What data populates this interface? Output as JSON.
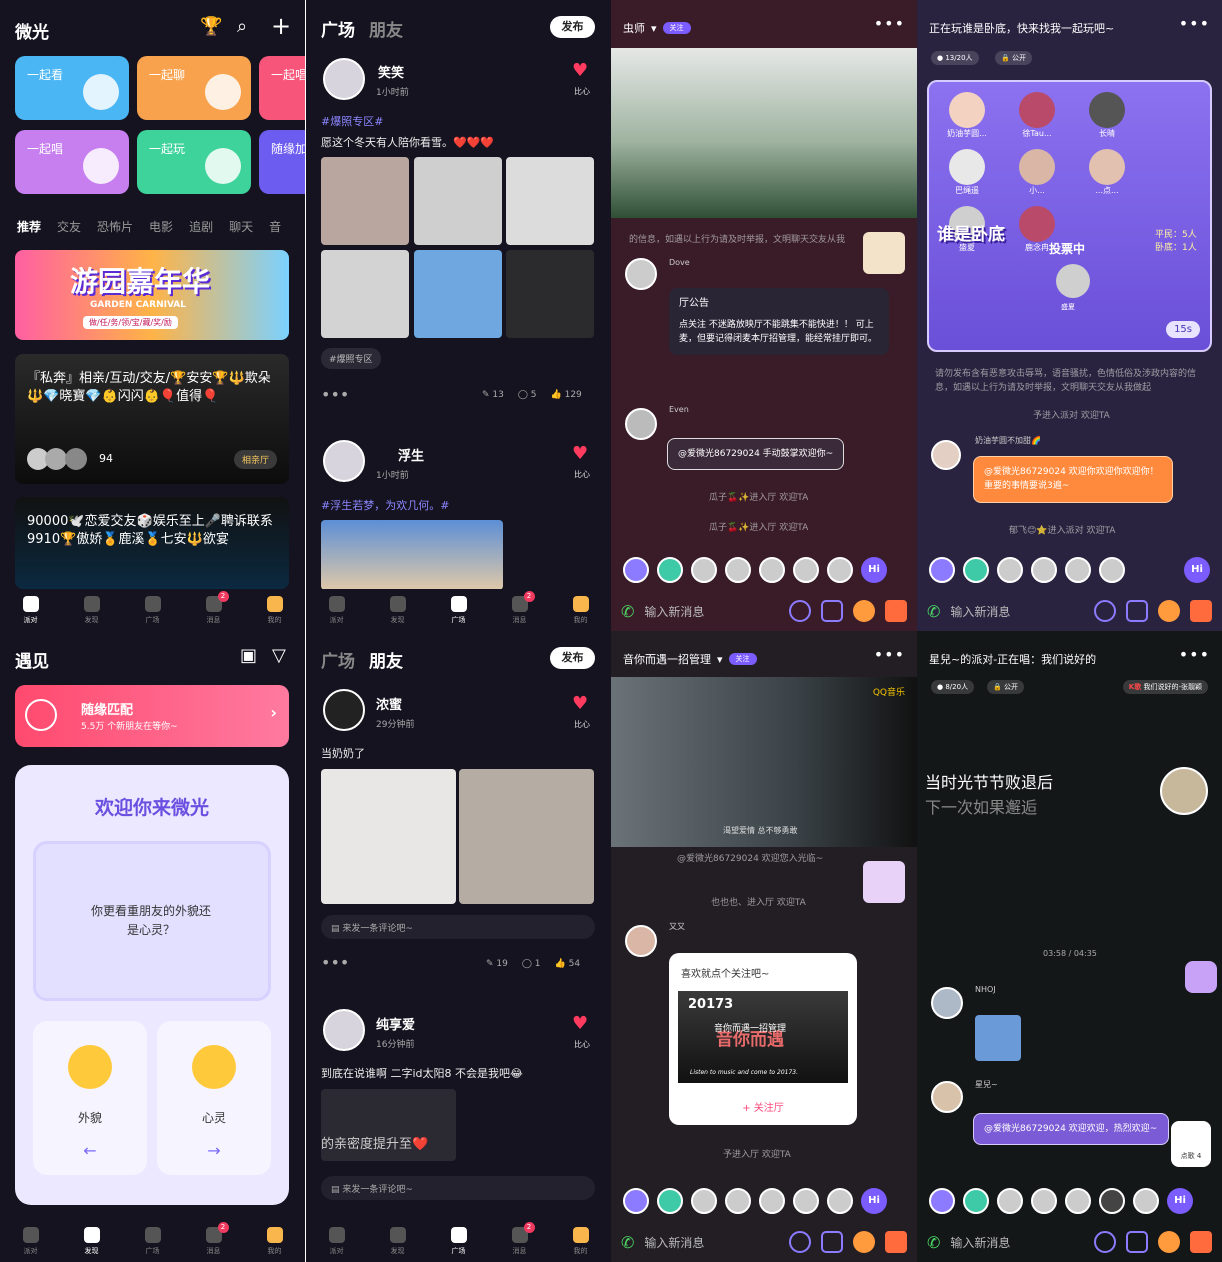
{
  "p1": {
    "title": "微光",
    "quick": [
      "一起看",
      "一起聊",
      "一起唱",
      "一起唱",
      "一起玩",
      "随缘加"
    ],
    "categories": [
      "推荐",
      "交友",
      "恐怖片",
      "电影",
      "追剧",
      "聊天",
      "音"
    ],
    "banner1": {
      "title": "游园嘉年华",
      "sub": "GARDEN CARNIVAL",
      "tags": "做/任/务/领/宝/藏/奖/励"
    },
    "room1": {
      "text": "『私奔』相亲/互动/交友/🏆安安🏆🔱欺朵🔱💎晓寶💎👶闪闪👶🎈值得🎈",
      "count": "94",
      "badge": "相亲厅"
    },
    "room2": {
      "text": "90000🕊️恋爱交友🎲娱乐至上🎤聘诉联系9910🏆傲娇🏅鹿溪🏅七安🔱欲宴"
    },
    "nav": [
      "派对",
      "发现",
      "广场",
      "消息",
      "我的"
    ],
    "nav_badge": "2"
  },
  "p2": {
    "tabs": [
      "广场",
      "朋友"
    ],
    "publish": "发布",
    "post1": {
      "name": "笑笑",
      "time": "1小时前",
      "tag": "#爆照专区#",
      "text": "愿这个冬天有人陪你看雪。❤️❤️❤️",
      "chip": "#爆照专区",
      "edits": "13",
      "comments": "5",
      "likes": "129"
    },
    "post2": {
      "name": "浮生",
      "time": "1小时前",
      "tag": "#浮生若梦，为欢几何。#"
    },
    "bixin": "比心",
    "nav": [
      "派对",
      "发现",
      "广场",
      "消息",
      "我的"
    ],
    "nav_badge": "2"
  },
  "p3": {
    "room": "虫师",
    "follow": "关注",
    "notice_head": "厅公告",
    "notice": "点关注 不迷路放映厅不能跳集不能快进！！ 可上麦，但要记得闭麦本厅招管理，能经常挂厅即可。",
    "sys_top": "的信息，如遇以上行为请及时举报，文明聊天交友从我",
    "user1": "Dove",
    "user2": "Even",
    "welcome": "@爱微光86729024 手动鼓掌欢迎你~",
    "join1": "瓜子🍒✨进入厅 欢迎TA",
    "join2": "瓜子🍒✨进入厅 欢迎TA",
    "input": "输入新消息",
    "hi": "Hi"
  },
  "p4": {
    "room": "正在玩谁是卧底，快来找我一起玩吧~",
    "count": "13/20人",
    "public": "公开",
    "game": "谁是卧底",
    "voting": "投票中",
    "civ": "平民：5人",
    "spy": "卧底：1人",
    "timer": "15s",
    "players": [
      "奶油芋圆...",
      "徐Tau...",
      "长晴",
      "巴绳遥",
      "小...",
      "...点...",
      "盛夏",
      "鹿念冉"
    ],
    "voted": "盛夏",
    "sys": "请勿发布含有恶意攻击辱骂，语音骚扰，色情低俗及涉政内容的信息，如遇以上行为请及时举报，文明聊天交友从我做起",
    "join1": "予进入派对 欢迎TA",
    "user": "奶油芋圆不加甜🌈",
    "welcome": "@爱微光86729024 欢迎你欢迎你欢迎你！重要的事情要说3遍~",
    "join2": "郁飞😊⭐进入派对 欢迎TA",
    "input": "输入新消息",
    "hi": "Hi"
  },
  "p5": {
    "title": "遇见",
    "match_title": "随缘匹配",
    "match_sub": "5.5万 个新朋友在等你~",
    "welcome": "欢迎你来微光",
    "question": "你更看重朋友的外貌还是心灵？",
    "opt1": "外貌",
    "opt2": "心灵",
    "nav": [
      "派对",
      "发现",
      "广场",
      "消息",
      "我的"
    ],
    "nav_badge": "2"
  },
  "p6": {
    "tabs": [
      "广场",
      "朋友"
    ],
    "publish": "发布",
    "post1": {
      "name": "浓蜜",
      "time": "29分钟前",
      "text": "当奶奶了",
      "comment": "来发一条评论吧~",
      "edits": "19",
      "comments": "1",
      "likes": "54"
    },
    "post2": {
      "name": "纯享爱",
      "time": "16分钟前",
      "text": "到底在说谁啊 二字id太阳8 不会是我吧😂",
      "overlay": "的亲密度提升至❤️",
      "comment": "来发一条评论吧~"
    },
    "bixin": "比心",
    "nav": [
      "派对",
      "发现",
      "广场",
      "消息",
      "我的"
    ],
    "nav_badge": "2"
  },
  "p7": {
    "room": "音你而遇一招管理",
    "follow": "关注",
    "video_label": "QQ音乐",
    "lyric": "渴望爱情 总不够勇敢",
    "top_msg": "@爱微光86729024 欢迎您入光临~",
    "join1": "也也也、进入厅 欢迎TA",
    "user": "又又",
    "card_title": "喜欢就点个关注吧~",
    "card_year": "20173",
    "card_art": "音你而遇",
    "card_sub": "Listen to music and come to 20173.",
    "card_name": "音你而遇一招管理",
    "card_btn": "+ 关注厅",
    "join2": "予进入厅 欢迎TA",
    "input": "输入新消息",
    "hi": "Hi"
  },
  "p8": {
    "room": "星兒~的派对-正在唱：我们说好的",
    "count": "8/20人",
    "public": "公开",
    "ktv": "我们说好的-张靓颖",
    "lyric1": "当时光节节败退后",
    "lyric2": "下一次如果邂逅",
    "time": "03:58 / 04:35",
    "user1": "NHOJ",
    "user2": "星兒~",
    "welcome": "@爱微光86729024 欢迎欢迎，热烈欢迎~",
    "song_btn": "点歌 4",
    "input": "输入新消息",
    "hi": "Hi"
  }
}
